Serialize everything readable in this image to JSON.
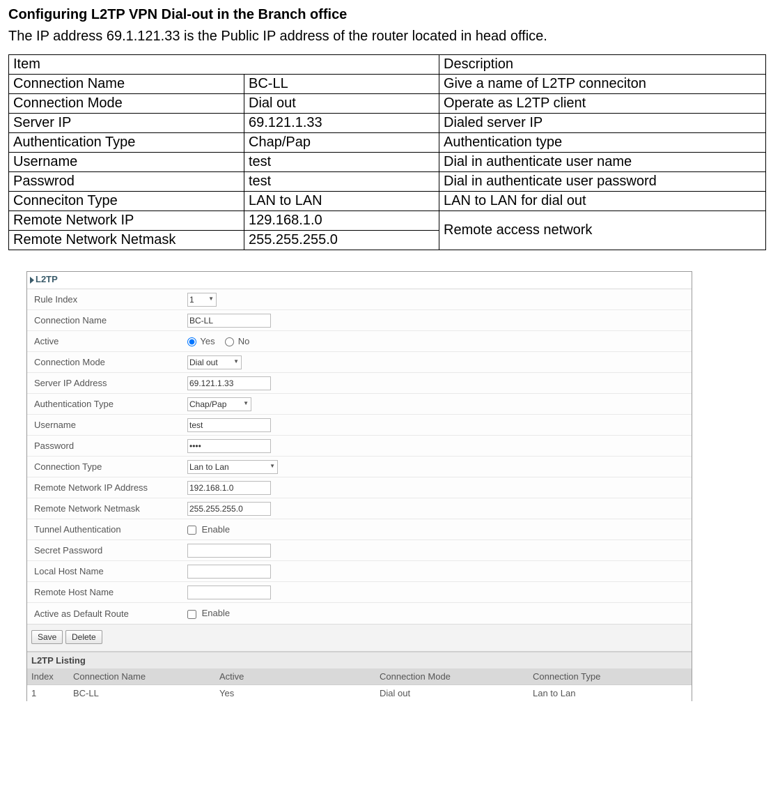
{
  "doc": {
    "title": "Configuring L2TP VPN Dial-out in the Branch office",
    "para": "The IP address 69.1.121.33 is the Public IP address of the router located in head office."
  },
  "spec": {
    "header": {
      "item": "Item",
      "desc": "Description"
    },
    "rows": [
      {
        "item": "Connection Name",
        "value": "BC-LL",
        "desc": "Give a name of L2TP conneciton"
      },
      {
        "item": "Connection Mode",
        "value": "Dial out",
        "desc": "Operate as L2TP client"
      },
      {
        "item": "Server IP",
        "value": "69.121.1.33",
        "desc": "Dialed server IP"
      },
      {
        "item": "Authentication Type",
        "value": "Chap/Pap",
        "desc": "Authentication type"
      },
      {
        "item": "Username",
        "value": "test",
        "desc": "Dial in authenticate user name"
      },
      {
        "item": "Passwrod",
        "value": "test",
        "desc": "Dial in authenticate user password"
      },
      {
        "item": "Conneciton Type",
        "value": "LAN to LAN",
        "desc": "LAN to LAN for dial out"
      },
      {
        "item": "Remote Network IP",
        "value": "129.168.1.0",
        "desc": "Remote access network"
      },
      {
        "item": "Remote Network Netmask",
        "value": "255.255.255.0",
        "desc": ""
      }
    ]
  },
  "panel": {
    "section_title": "L2TP",
    "fields": {
      "rule_index": {
        "label": "Rule Index",
        "value": "1"
      },
      "conn_name": {
        "label": "Connection Name",
        "value": "BC-LL"
      },
      "active": {
        "label": "Active",
        "yes": "Yes",
        "no": "No"
      },
      "conn_mode": {
        "label": "Connection Mode",
        "value": "Dial out"
      },
      "server_ip": {
        "label": "Server IP Address",
        "value": "69.121.1.33"
      },
      "auth_type": {
        "label": "Authentication Type",
        "value": "Chap/Pap"
      },
      "username": {
        "label": "Username",
        "value": "test"
      },
      "password": {
        "label": "Password",
        "value": "••••"
      },
      "conn_type": {
        "label": "Connection Type",
        "value": "Lan to Lan"
      },
      "remote_ip": {
        "label": "Remote Network IP Address",
        "value": "192.168.1.0"
      },
      "remote_mask": {
        "label": "Remote Network Netmask",
        "value": "255.255.255.0"
      },
      "tunnel_auth": {
        "label": "Tunnel Authentication",
        "enable": "Enable"
      },
      "secret_pw": {
        "label": "Secret Password",
        "value": ""
      },
      "local_host": {
        "label": "Local Host Name",
        "value": ""
      },
      "remote_host": {
        "label": "Remote Host Name",
        "value": ""
      },
      "default_route": {
        "label": "Active as Default Route",
        "enable": "Enable"
      }
    },
    "buttons": {
      "save": "Save",
      "delete": "Delete"
    },
    "listing": {
      "title": "L2TP Listing",
      "headers": {
        "index": "Index",
        "name": "Connection Name",
        "active": "Active",
        "mode": "Connection Mode",
        "type": "Connection Type"
      },
      "rows": [
        {
          "index": "1",
          "name": "BC-LL",
          "active": "Yes",
          "mode": "Dial out",
          "type": "Lan to Lan"
        }
      ]
    }
  }
}
